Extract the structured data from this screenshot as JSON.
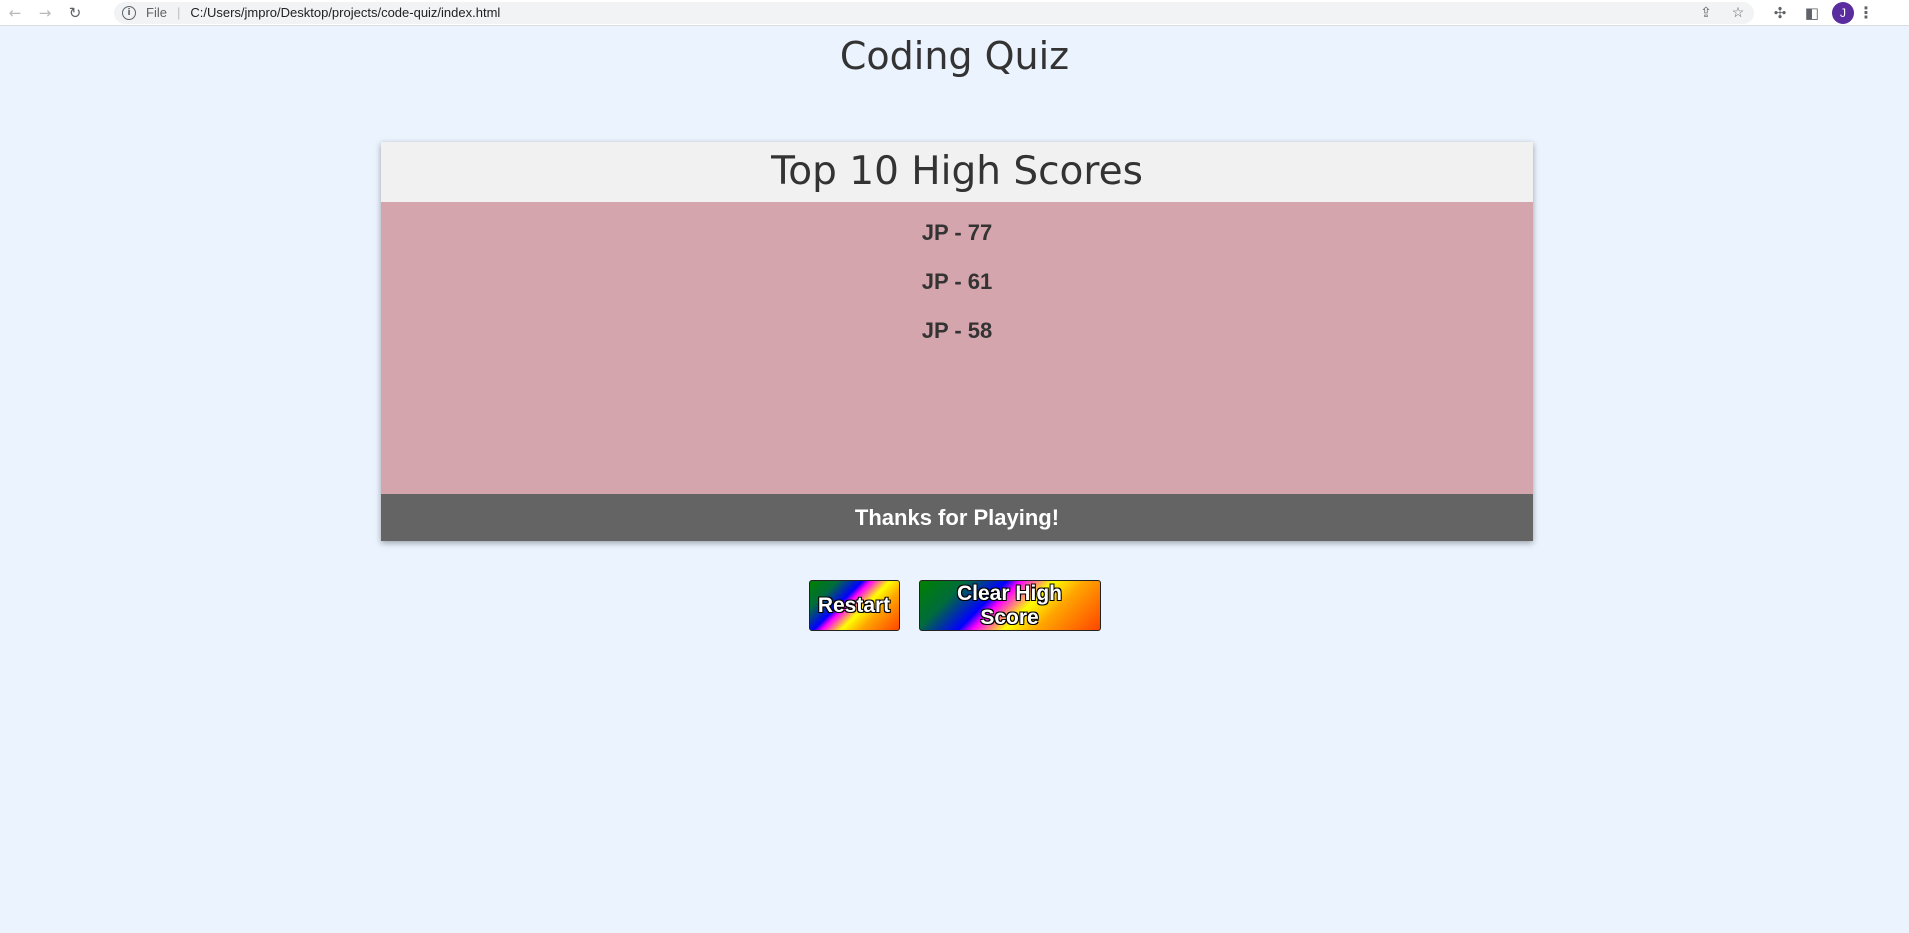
{
  "browser": {
    "back_icon": "←",
    "forward_icon": "→",
    "reload_icon": "↻",
    "info_icon": "i",
    "file_label": "File",
    "url": "C:/Users/jmpro/Desktop/projects/code-quiz/index.html",
    "share_icon": "⇪",
    "star_icon": "☆",
    "extensions_icon": "✣",
    "sidepanel_icon": "◧",
    "avatar_letter": "J",
    "menu_icon": "⋮"
  },
  "page": {
    "title": "Coding Quiz"
  },
  "card": {
    "header": "Top 10 High Scores",
    "scores": [
      "JP - 77",
      "JP - 61",
      "JP - 58"
    ],
    "footer": "Thanks for Playing!"
  },
  "buttons": {
    "restart_label": "Restart",
    "clear_label": "Clear High Score"
  },
  "colors": {
    "page_background": "#ebf3fe",
    "card_header_background": "#f1f1f1",
    "card_body_background": "#d4a5ac",
    "card_footer_background": "#646464",
    "avatar": "#5a2ca0"
  }
}
